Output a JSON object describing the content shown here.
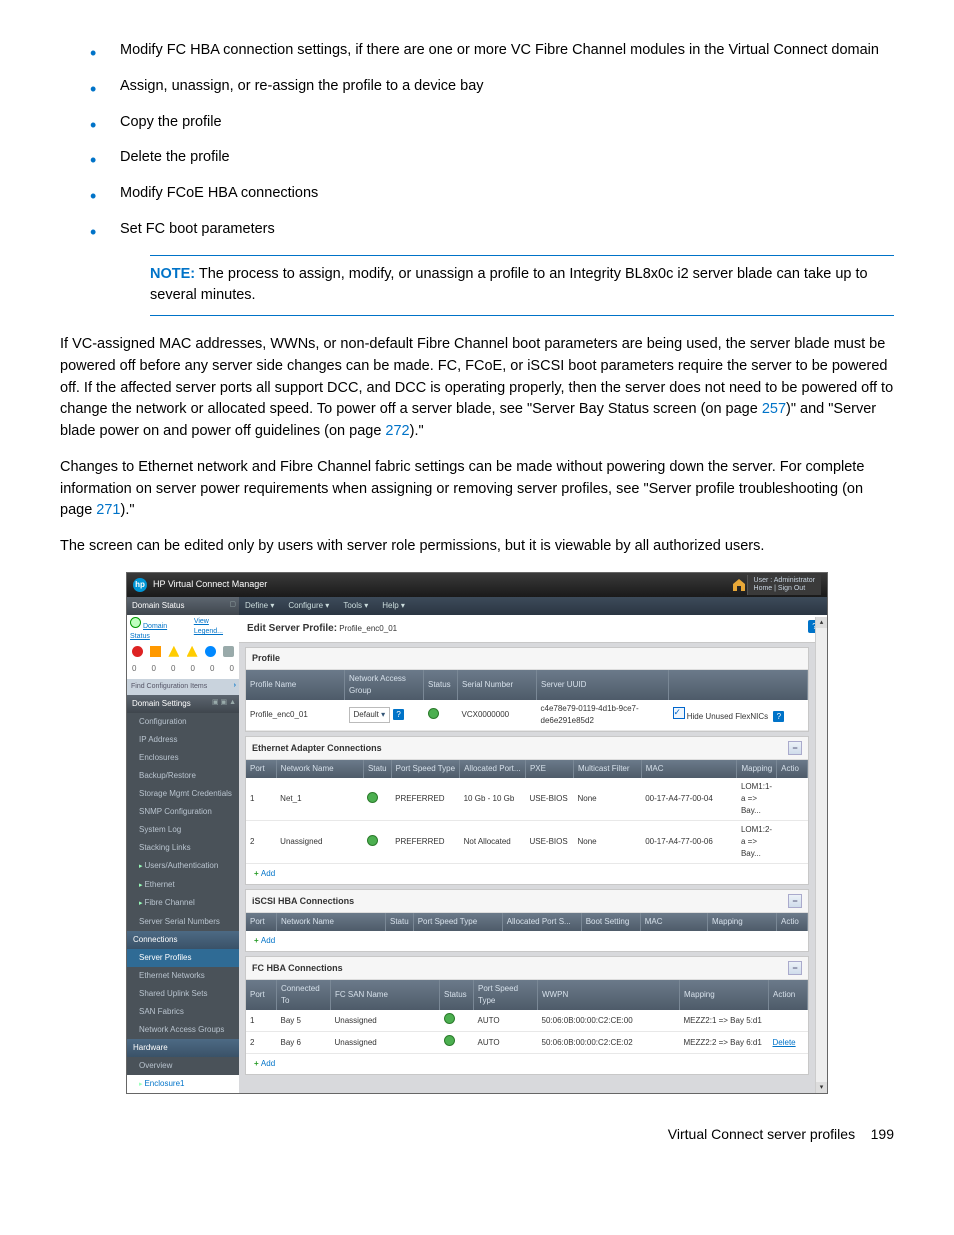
{
  "bullets": [
    "Modify FC HBA connection settings, if there are one or more VC Fibre Channel modules in the Virtual Connect domain",
    "Assign, unassign, or re-assign the profile to a device bay",
    "Copy the profile",
    "Delete the profile",
    "Modify FCoE HBA connections",
    "Set FC boot parameters"
  ],
  "note": {
    "label": "NOTE:",
    "text": "The process to assign, modify, or unassign a profile to an Integrity BL8x0c i2 server blade can take up to several minutes."
  },
  "para1a": "If VC-assigned MAC addresses, WWNs, or non-default Fibre Channel boot parameters are being used, the server blade must be powered off before any server side changes can be made. FC, FCoE, or iSCSI boot parameters require the server to be powered off. If the affected server ports all support DCC, and DCC is operating properly, then the server does not need to be powered off to change the network or allocated speed. To power off a server blade, see \"Server Bay Status screen (on page ",
  "link1": "257",
  "para1b": ")\" and \"Server blade power on and power off guidelines (on page ",
  "link2": "272",
  "para1c": ").\"",
  "para2a": "Changes to Ethernet network and Fibre Channel fabric settings can be made without powering down the server. For complete information on server power requirements when assigning or removing server profiles, see \"Server profile troubleshooting (on page ",
  "link3": "271",
  "para2b": ").\"",
  "para3": "The screen can be edited only by users with server role permissions, but it is viewable by all authorized users.",
  "footer": {
    "left": "Virtual Connect server profiles",
    "right": "199"
  },
  "vcm": {
    "title": "HP Virtual Connect Manager",
    "hp": "hp",
    "user_lines": [
      "User : Administrator",
      "Home  |  Sign Out"
    ],
    "side": {
      "domain_status": "Domain Status",
      "ds_link": "Domain Status",
      "vl_link": "View Legend...",
      "zeros": [
        "0",
        "0",
        "0",
        "0",
        "0",
        "0"
      ],
      "find": "Find Configuration Items",
      "settings_hd": "Domain Settings",
      "settings": [
        "Configuration",
        "IP Address",
        "Enclosures",
        "Backup/Restore",
        "Storage Mgmt Credentials",
        "SNMP Configuration",
        "System Log",
        "Stacking Links"
      ],
      "users": "Users/Authentication",
      "eth": "Ethernet",
      "fc": "Fibre Channel",
      "ssn": "Server Serial Numbers",
      "conn_hd": "Connections",
      "conn": [
        "Server Profiles",
        "Ethernet Networks",
        "Shared Uplink Sets",
        "SAN Fabrics",
        "Network Access Groups"
      ],
      "hw_hd": "Hardware",
      "hw": [
        "Overview"
      ],
      "enc": "Enclosure1"
    },
    "menubar": [
      "Define ▾",
      "Configure ▾",
      "Tools ▾",
      "Help ▾"
    ],
    "page_title": "Edit Server Profile:",
    "page_title_val": "Profile_enc0_01",
    "profile": {
      "hd": "Profile",
      "cols": [
        "Profile Name",
        "Network Access Group",
        "Status",
        "Serial Number",
        "Server UUID"
      ],
      "name": "Profile_enc0_01",
      "nag": "Default",
      "serial": "VCX0000000",
      "uuid": "c4e78e79-0119-4d1b-9ce7-de6e291e85d2",
      "chk_label": "Hide Unused FlexNICs",
      "help": "?"
    },
    "eth_sec": {
      "hd": "Ethernet Adapter Connections",
      "cols": [
        "Port",
        "Network Name",
        "Statu",
        "Port Speed Type",
        "Allocated Port...",
        "PXE",
        "Multicast Filter",
        "MAC",
        "Mapping",
        "Actio"
      ],
      "rows": [
        {
          "port": "1",
          "net": "Net_1",
          "pst": "PREFERRED",
          "alloc": "10 Gb - 10 Gb",
          "pxe": "USE-BIOS",
          "mc": "None",
          "mac": "00-17-A4-77-00-04",
          "map": "LOM1:1-a => Bay..."
        },
        {
          "port": "2",
          "net": "Unassigned",
          "pst": "PREFERRED",
          "alloc": "Not Allocated",
          "pxe": "USE-BIOS",
          "mc": "None",
          "mac": "00-17-A4-77-00-06",
          "map": "LOM1:2-a => Bay..."
        }
      ],
      "add": "Add"
    },
    "iscsi": {
      "hd": "iSCSI HBA Connections",
      "cols": [
        "Port",
        "Network Name",
        "Statu",
        "Port Speed Type",
        "Allocated Port S...",
        "Boot Setting",
        "MAC",
        "Mapping",
        "Actio"
      ],
      "add": "Add"
    },
    "fchba": {
      "hd": "FC HBA Connections",
      "cols": [
        "Port",
        "Connected To",
        "FC SAN Name",
        "Status",
        "Port Speed Type",
        "WWPN",
        "Mapping",
        "Action"
      ],
      "rows": [
        {
          "port": "1",
          "ct": "Bay 5",
          "san": "Unassigned",
          "pst": "AUTO",
          "wwpn": "50:06:0B:00:00:C2:CE:00",
          "map": "MEZZ2:1 => Bay 5:d1",
          "act": ""
        },
        {
          "port": "2",
          "ct": "Bay 6",
          "san": "Unassigned",
          "pst": "AUTO",
          "wwpn": "50:06:0B:00:00:C2:CE:02",
          "map": "MEZZ2:2 => Bay 6:d1",
          "act": "Delete"
        }
      ],
      "add": "Add"
    }
  }
}
